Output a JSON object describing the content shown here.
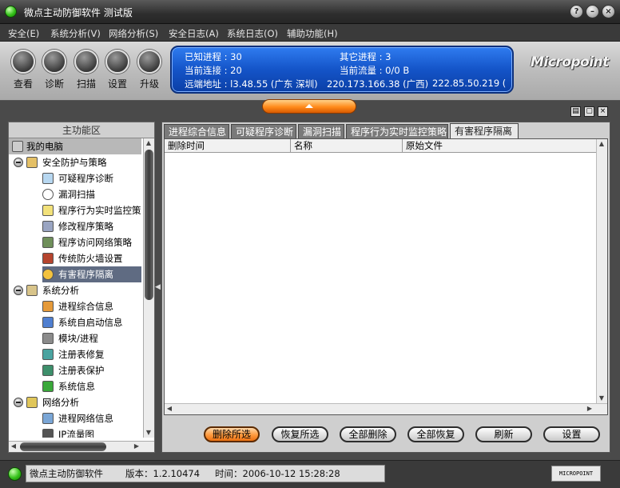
{
  "window": {
    "title": "微点主动防御软件  测试版"
  },
  "menu": [
    "安全(E)",
    "系统分析(V)",
    "网络分析(S)",
    "安全日志(A)",
    "系统日志(O)",
    "辅助功能(H)"
  ],
  "toolbar": {
    "buttons": [
      {
        "label": "查看",
        "icon": "magnifier-icon"
      },
      {
        "label": "诊断",
        "icon": "heart-icon"
      },
      {
        "label": "扫描",
        "icon": "scan-icon"
      },
      {
        "label": "设置",
        "icon": "hand-icon"
      },
      {
        "label": "升级",
        "icon": "up-arrow-icon"
      }
    ]
  },
  "info": {
    "known_proc": "已知进程 : 30",
    "other_proc": "其它进程 : 3",
    "cur_conn": "当前连接 : 20",
    "cur_flow": "当前流量 : 0/0 B",
    "remote_addr": "远端地址 : l3.48.55 (广东 深圳)",
    "remote2": "220.173.166.38 (广西)",
    "remote3": "222.85.50.219 ("
  },
  "logo": {
    "text": "Micropoint"
  },
  "sidebar": {
    "header": "主功能区",
    "items": [
      {
        "label": "我的电脑"
      },
      {
        "label": "安全防护与策略"
      },
      {
        "label": "可疑程序诊断"
      },
      {
        "label": "漏洞扫描"
      },
      {
        "label": "程序行为实时监控策"
      },
      {
        "label": "修改程序策略"
      },
      {
        "label": "程序访问网络策略"
      },
      {
        "label": "传统防火墙设置"
      },
      {
        "label": "有害程序隔离"
      },
      {
        "label": "系统分析"
      },
      {
        "label": "进程综合信息"
      },
      {
        "label": "系统自启动信息"
      },
      {
        "label": "模块/进程"
      },
      {
        "label": "注册表修复"
      },
      {
        "label": "注册表保护"
      },
      {
        "label": "系统信息"
      },
      {
        "label": "网络分析"
      },
      {
        "label": "进程网络信息"
      },
      {
        "label": "IP流量图"
      }
    ]
  },
  "tabs": [
    "进程综合信息",
    "可疑程序诊断",
    "漏洞扫描",
    "程序行为实时监控策略",
    "有害程序隔离"
  ],
  "table": {
    "columns": [
      "删除时间",
      "名称",
      "原始文件"
    ]
  },
  "actions": [
    "删除所选",
    "恢复所选",
    "全部删除",
    "全部恢复",
    "刷新",
    "设置"
  ],
  "statusbar": {
    "app": "微点主动防御软件",
    "version": "版本：1.2.10474",
    "time": "时间：2006-10-12 15:28:28",
    "brand": "MICROPOINT"
  }
}
